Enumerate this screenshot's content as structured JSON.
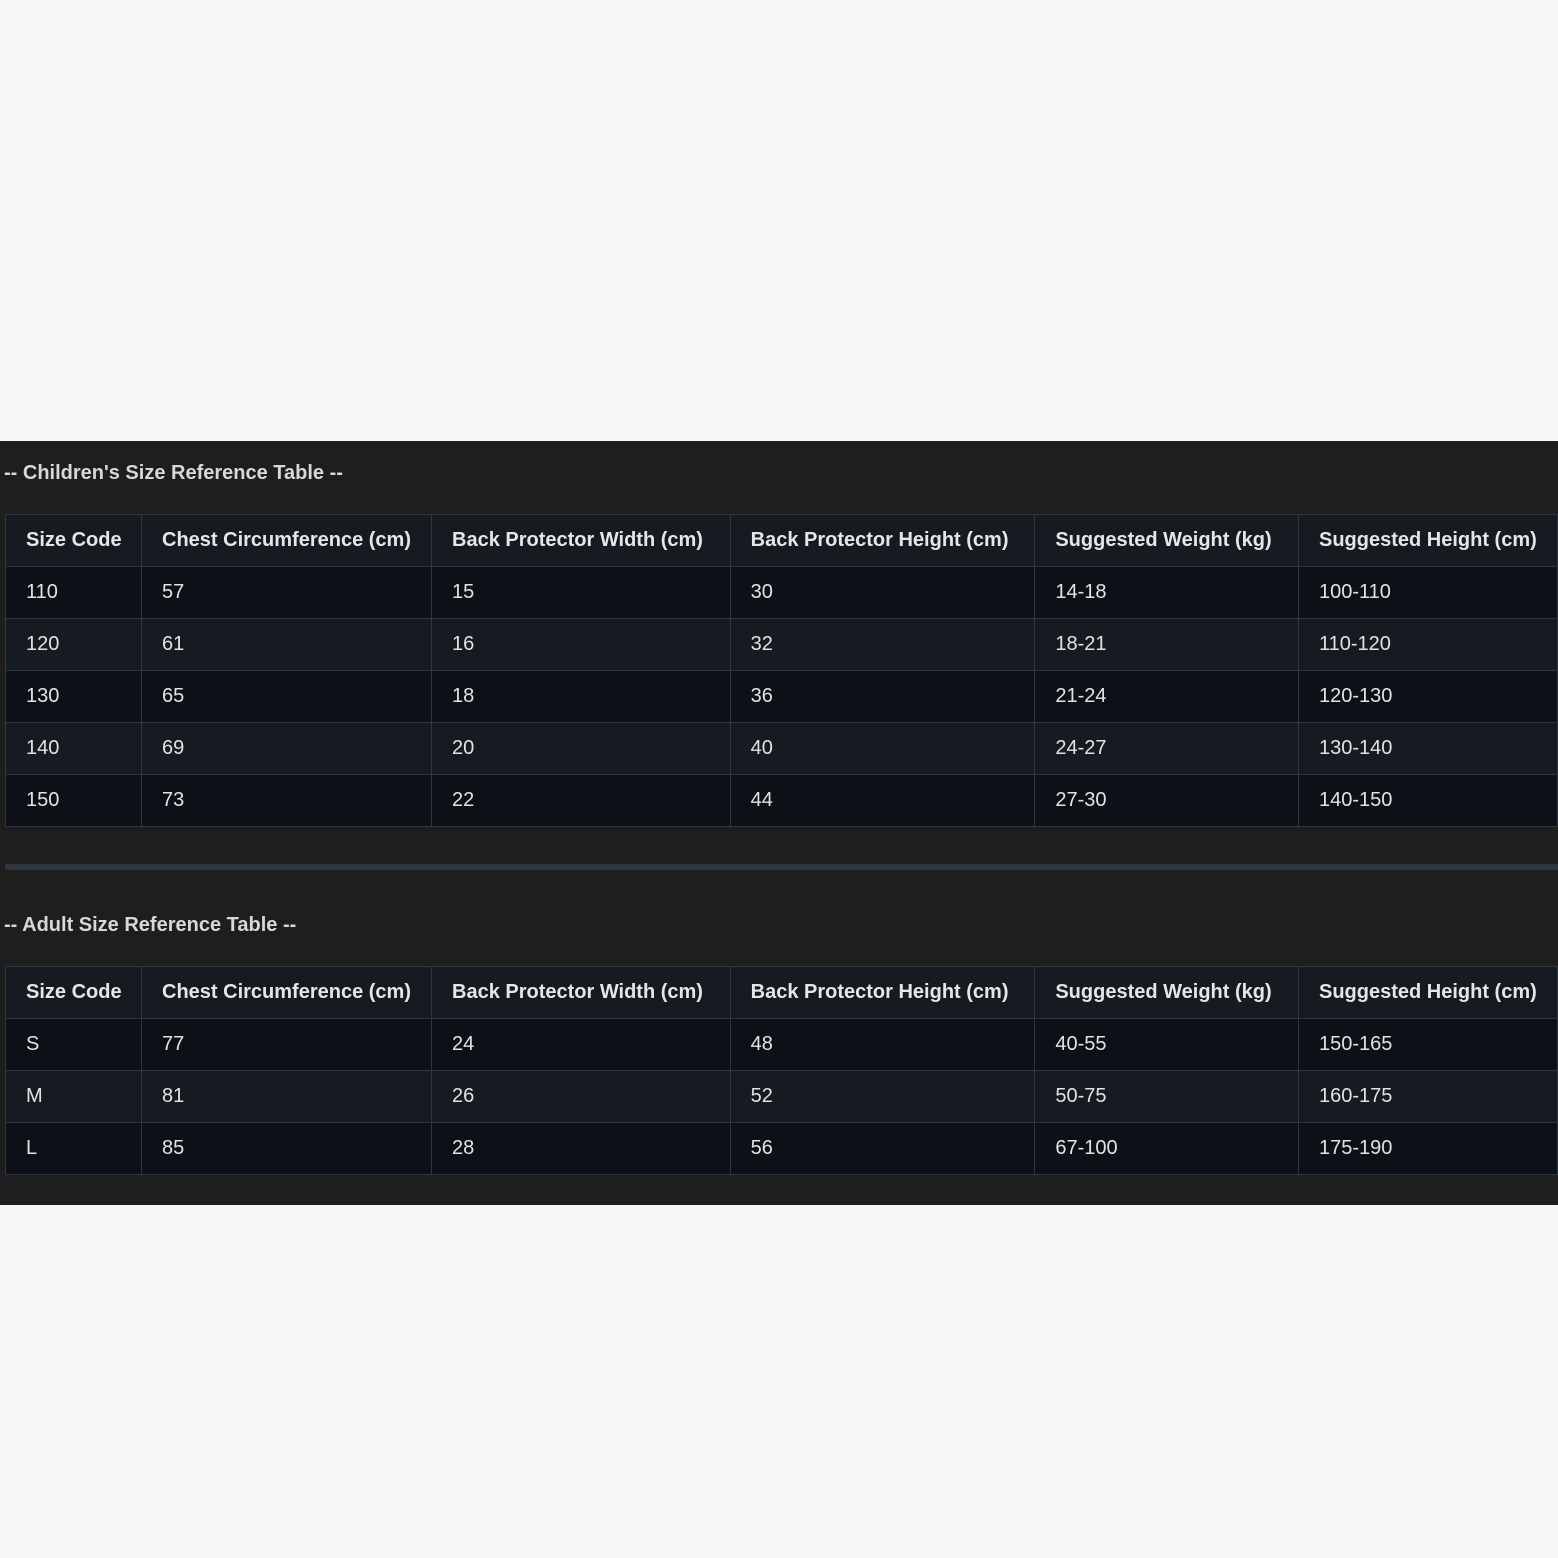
{
  "children": {
    "title": "-- Children's Size Reference Table --",
    "headers": [
      "Size Code",
      "Chest Circumference (cm)",
      "Back Protector Width (cm)",
      "Back Protector Height (cm)",
      "Suggested Weight (kg)",
      "Suggested Height (cm)"
    ],
    "rows": [
      [
        "110",
        "57",
        "15",
        "30",
        "14-18",
        "100-110"
      ],
      [
        "120",
        "61",
        "16",
        "32",
        "18-21",
        "110-120"
      ],
      [
        "130",
        "65",
        "18",
        "36",
        "21-24",
        "120-130"
      ],
      [
        "140",
        "69",
        "20",
        "40",
        "24-27",
        "130-140"
      ],
      [
        "150",
        "73",
        "22",
        "44",
        "27-30",
        "140-150"
      ]
    ]
  },
  "adult": {
    "title": "-- Adult Size Reference Table --",
    "headers": [
      "Size Code",
      "Chest Circumference (cm)",
      "Back Protector Width (cm)",
      "Back Protector Height (cm)",
      "Suggested Weight (kg)",
      "Suggested Height (cm)"
    ],
    "rows": [
      [
        "S",
        "77",
        "24",
        "48",
        "40-55",
        "150-165"
      ],
      [
        "M",
        "81",
        "26",
        "52",
        "50-75",
        "160-175"
      ],
      [
        "L",
        "85",
        "28",
        "56",
        "67-100",
        "175-190"
      ]
    ]
  }
}
